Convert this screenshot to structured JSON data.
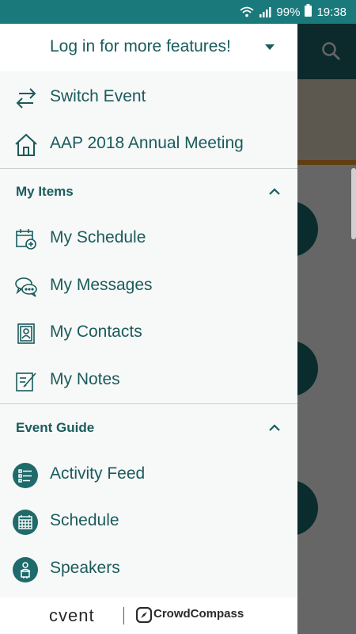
{
  "status_bar": {
    "battery": "99%",
    "time": "19:38"
  },
  "drawer": {
    "header": "Log in for more features!",
    "top_items": [
      {
        "label": "Switch Event",
        "icon": "swap-arrows-icon"
      },
      {
        "label": "AAP 2018 Annual Meeting",
        "icon": "home-icon"
      }
    ],
    "sections": [
      {
        "title": "My Items",
        "items": [
          {
            "label": "My Schedule",
            "icon": "calendar-add-icon"
          },
          {
            "label": "My Messages",
            "icon": "chat-bubbles-icon"
          },
          {
            "label": "My Contacts",
            "icon": "contact-card-icon"
          },
          {
            "label": "My Notes",
            "icon": "note-pencil-icon"
          }
        ]
      },
      {
        "title": "Event Guide",
        "items": [
          {
            "label": "Activity Feed",
            "icon": "activity-feed-icon"
          },
          {
            "label": "Schedule",
            "icon": "calendar-grid-icon"
          },
          {
            "label": "Speakers",
            "icon": "speaker-podium-icon"
          }
        ]
      }
    ],
    "footer": {
      "brand_primary": "cvent",
      "brand_secondary": "CrowdCompass"
    }
  },
  "colors": {
    "accent": "#1f6a6b",
    "text": "#1b5b5c",
    "status_bar": "#1a7a7b"
  }
}
